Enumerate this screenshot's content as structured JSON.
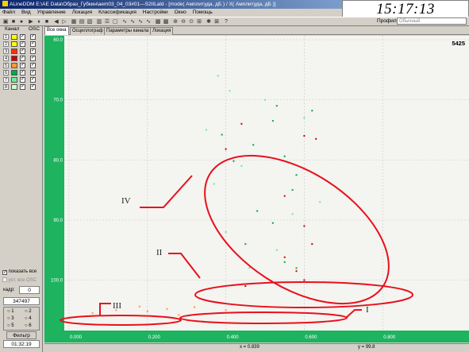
{
  "window": {
    "title": "ALineDDM E:\\AE Data\\Образ_Губкин\\aem03_04_03#01—S2IILald - [mode( Амплитуда, дБ ) / X( Амплитуда, дБ )]",
    "clock": "15:17:13"
  },
  "menu": [
    "Файл",
    "Вид",
    "Управление",
    "Локация",
    "Классификация",
    "Настройки",
    "Окно",
    "Помощь"
  ],
  "toolbar": {
    "profiles_label": "Профили",
    "profile_value": "Обычный"
  },
  "left_panel": {
    "header_channel": "Канал",
    "header_osc": "OSC",
    "channels": [
      {
        "num": "1",
        "color": "#ffff00"
      },
      {
        "num": "2",
        "color": "#ffff00"
      },
      {
        "num": "3",
        "color": "#ff3300"
      },
      {
        "num": "4",
        "color": "#cc0000"
      },
      {
        "num": "5",
        "color": "#ff9933"
      },
      {
        "num": "6",
        "color": "#00aa44"
      },
      {
        "num": "7",
        "color": "#66ee99"
      },
      {
        "num": "8",
        "color": "#ccffcc"
      }
    ],
    "show_all": "показать все",
    "osc_all": "уст. все OSC",
    "frame_label": "кадр:",
    "frame_value": "0",
    "count_value": "347497",
    "radio_labels": [
      "1",
      "2",
      "3",
      "4",
      "5",
      "6"
    ],
    "filter_button": "Фильтр",
    "elapsed": "01:32:19"
  },
  "tabs": [
    "Все окна",
    "Осциллограф",
    "Параметры канала",
    "Локация"
  ],
  "plot": {
    "counter": "5425",
    "y_ticks": [
      "100.0",
      "90.0",
      "80.0",
      "70.0",
      "60.0"
    ],
    "x_ticks": [
      "0.000",
      "0.200",
      "0.400",
      "0.600",
      "0.800"
    ],
    "annotations": [
      "IV",
      "II",
      "III",
      "I"
    ]
  },
  "status": {
    "x_readout": "x = 0.839",
    "y_readout": "y = 99.8"
  },
  "chart_data": {
    "type": "scatter",
    "title": "",
    "xlabel": "",
    "ylabel": "",
    "xlim": [
      0,
      1.0
    ],
    "ylim": [
      52,
      100
    ],
    "x_ticks": [
      0,
      0.2,
      0.4,
      0.6,
      0.8
    ],
    "y_ticks": [
      60,
      70,
      80,
      90,
      100
    ],
    "series": [
      {
        "color": "#00aa44",
        "points": [
          [
            0.53,
            89.0
          ],
          [
            0.52,
            86.5
          ],
          [
            0.62,
            88.2
          ],
          [
            0.39,
            84.2
          ],
          [
            0.47,
            82.5
          ],
          [
            0.55,
            80.6
          ],
          [
            0.42,
            79.8
          ],
          [
            0.58,
            77.5
          ],
          [
            0.57,
            75.0
          ],
          [
            0.48,
            71.5
          ],
          [
            0.52,
            69.5
          ],
          [
            0.45,
            66.0
          ],
          [
            0.55,
            63.0
          ],
          [
            0.58,
            62.0
          ]
        ]
      },
      {
        "color": "#cc0000",
        "points": [
          [
            0.44,
            86.0
          ],
          [
            0.6,
            84.0
          ],
          [
            0.63,
            83.5
          ],
          [
            0.4,
            81.8
          ],
          [
            0.55,
            74.0
          ],
          [
            0.6,
            69.0
          ],
          [
            0.62,
            66.0
          ],
          [
            0.55,
            63.8
          ],
          [
            0.58,
            61.5
          ],
          [
            0.6,
            60.0
          ],
          [
            0.45,
            59.0
          ]
        ]
      },
      {
        "color": "#66ee99",
        "points": [
          [
            0.38,
            94.0
          ],
          [
            0.41,
            91.5
          ],
          [
            0.5,
            90.0
          ],
          [
            0.6,
            87.0
          ],
          [
            0.35,
            85.0
          ],
          [
            0.44,
            79.0
          ],
          [
            0.37,
            76.0
          ],
          [
            0.57,
            71.0
          ],
          [
            0.64,
            73.0
          ],
          [
            0.4,
            68.0
          ],
          [
            0.53,
            65.0
          ],
          [
            0.46,
            62.0
          ]
        ]
      },
      {
        "color": "#ff9933",
        "points": [
          [
            0.06,
            54.5
          ],
          [
            0.12,
            55.0
          ],
          [
            0.2,
            54.8
          ],
          [
            0.25,
            55.2
          ],
          [
            0.28,
            54.2
          ],
          [
            0.32,
            55.5
          ],
          [
            0.18,
            55.6
          ],
          [
            0.4,
            55.0
          ]
        ]
      }
    ]
  }
}
